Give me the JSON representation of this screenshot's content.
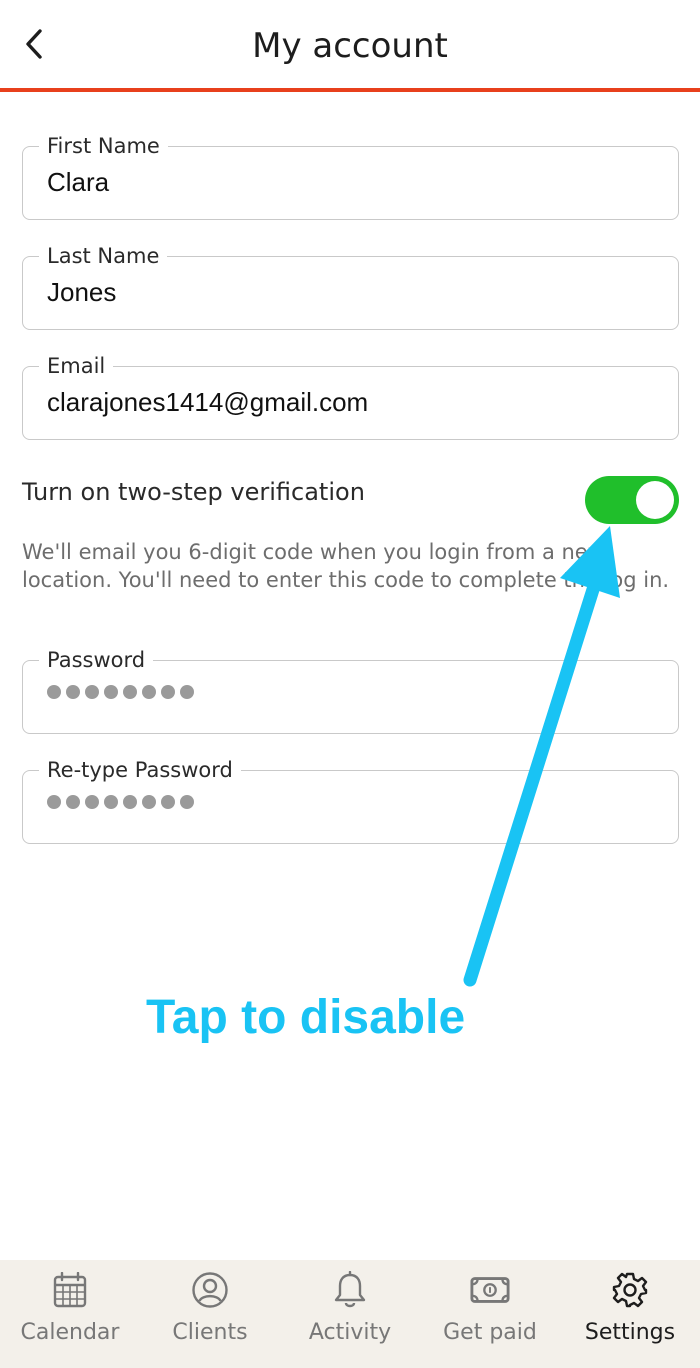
{
  "header": {
    "title": "My account",
    "back_icon": "chevron-left-icon"
  },
  "form": {
    "first_name": {
      "label": "First Name",
      "value": "Clara"
    },
    "last_name": {
      "label": "Last Name",
      "value": "Jones"
    },
    "email": {
      "label": "Email",
      "value": "clarajones1414@gmail.com"
    },
    "two_step": {
      "label": "Turn on two-step verification",
      "enabled": true,
      "help": "We'll email you 6-digit code when you login from a new location. You'll need to enter this code to complete the log in."
    },
    "password": {
      "label": "Password",
      "masked_length": 8
    },
    "retype_password": {
      "label": "Re-type Password",
      "masked_length": 8
    }
  },
  "annotation": {
    "text": "Tap to disable",
    "color": "#19c3f4"
  },
  "nav": {
    "items": [
      {
        "label": "Calendar",
        "icon": "calendar-icon",
        "active": false
      },
      {
        "label": "Clients",
        "icon": "user-circle-icon",
        "active": false
      },
      {
        "label": "Activity",
        "icon": "bell-icon",
        "active": false
      },
      {
        "label": "Get paid",
        "icon": "banknote-icon",
        "active": false
      },
      {
        "label": "Settings",
        "icon": "gear-icon",
        "active": true
      }
    ]
  },
  "colors": {
    "accent": "#e8401c",
    "toggle_on": "#20bf2b",
    "nav_background": "#f3f0ea"
  }
}
